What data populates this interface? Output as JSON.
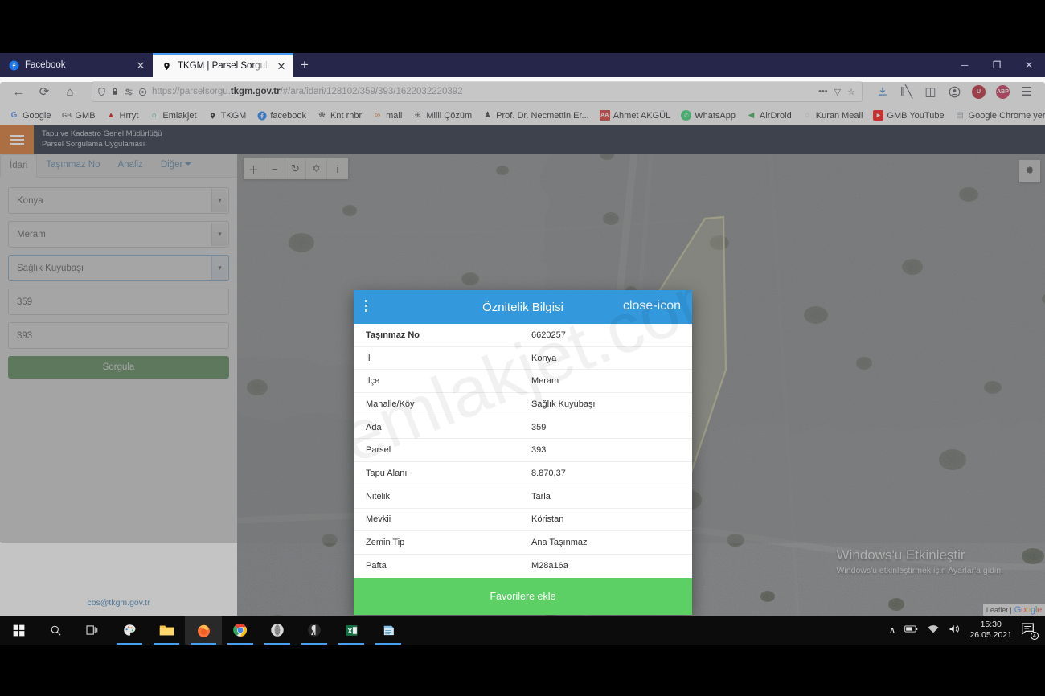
{
  "browser": {
    "tabs": [
      {
        "title": "Facebook",
        "icon": "facebook-icon",
        "active": false
      },
      {
        "title": "TKGM | Parsel Sorgulama Uygu",
        "icon": "map-pin-icon",
        "active": true
      }
    ],
    "new_tab_label": "+",
    "window_controls": {
      "minimize": "─",
      "maximize": "❐",
      "close": "✕"
    },
    "nav": {
      "back": "←",
      "forward": "→",
      "reload": "⟳",
      "home": "⌂"
    },
    "url": {
      "prefix": "https://parselsorgu.",
      "domain": "tkgm.gov.tr",
      "path": "/#/ara/idari/128102/359/393/1622032220392"
    },
    "url_actions": {
      "more": "•••",
      "pocket": "▽",
      "bookmark": "☆"
    },
    "toolbar_right": [
      {
        "name": "downloads-icon",
        "glyph": "⬇"
      },
      {
        "name": "library-icon",
        "glyph": "‖╲"
      },
      {
        "name": "sidebar-icon",
        "glyph": "◫"
      },
      {
        "name": "account-icon",
        "glyph": "◉"
      },
      {
        "name": "ublock-icon",
        "label": "U"
      },
      {
        "name": "adblockplus-icon",
        "label": "ABP"
      },
      {
        "name": "app-menu-icon",
        "glyph": "☰"
      }
    ],
    "bookmarks": [
      {
        "label": "Google",
        "icon": "G",
        "color": "#4285F4"
      },
      {
        "label": "GMB",
        "icon": "GB",
        "color": "#5f6368"
      },
      {
        "label": "Hrryt",
        "icon": "▲",
        "color": "#c00"
      },
      {
        "label": "Emlakjet",
        "icon": "⌂",
        "color": "#16a34a"
      },
      {
        "label": "TKGM",
        "icon": "⚉",
        "color": "#111"
      },
      {
        "label": "facebook",
        "icon": "f",
        "color": "#1877F2"
      },
      {
        "label": "Knt rhbr",
        "icon": "☸",
        "color": "#444"
      },
      {
        "label": "mail",
        "icon": "∞",
        "color": "#e07820"
      },
      {
        "label": "Milli Çözüm",
        "icon": "⊕",
        "color": "#333"
      },
      {
        "label": "Prof. Dr. Necmettin Er...",
        "icon": "♟",
        "color": "#333"
      },
      {
        "label": "Ahmet AKGÜL",
        "icon": "AA",
        "color": "#d32f2f"
      },
      {
        "label": "WhatsApp",
        "icon": "✆",
        "color": "#25D366"
      },
      {
        "label": "AirDroid",
        "icon": "◀",
        "color": "#2fa84f"
      },
      {
        "label": "Kuran Meali",
        "icon": "◌",
        "color": "#888"
      },
      {
        "label": "GMB YouTube",
        "icon": "▶",
        "color": "#FF0000"
      },
      {
        "label": "Google Chrome yer i...",
        "icon": "▤",
        "color": "#9aa0a6"
      }
    ]
  },
  "app": {
    "header": {
      "org_line1": "Tapu ve Kadastro Genel Müdürlüğü",
      "org_line2": "Parsel Sorgulama Uygulaması",
      "menu_icon": "hamburger-icon"
    },
    "sidebar": {
      "tabs": [
        {
          "label": "İdari",
          "active": true
        },
        {
          "label": "Taşınmaz No",
          "active": false
        },
        {
          "label": "Analiz",
          "active": false
        },
        {
          "label": "Diğer",
          "active": false,
          "has_caret": true
        }
      ],
      "fields": [
        {
          "name": "il-select",
          "type": "select",
          "value": "Konya"
        },
        {
          "name": "ilce-select",
          "type": "select",
          "value": "Meram"
        },
        {
          "name": "mahalle-select",
          "type": "select",
          "value": "Sağlık Kuyubaşı",
          "focused": true
        },
        {
          "name": "ada-input",
          "type": "text",
          "value": "359"
        },
        {
          "name": "parsel-input",
          "type": "text",
          "value": "393"
        }
      ],
      "submit_label": "Sorgula",
      "footer_link": "cbs@tkgm.gov.tr"
    },
    "map": {
      "controls": [
        {
          "name": "zoom-in-icon",
          "glyph": "＋"
        },
        {
          "name": "zoom-out-icon",
          "glyph": "−"
        },
        {
          "name": "refresh-icon",
          "glyph": "↻"
        },
        {
          "name": "locate-icon",
          "glyph": "✡"
        },
        {
          "name": "info-icon",
          "glyph": "і"
        }
      ],
      "settings_icon": "gear-icon",
      "attribution_prefix": "Leaflet |",
      "attribution_brand": "Google",
      "parcel_outline_color": "#e8e6a8"
    },
    "modal": {
      "title": "Öznitelik Bilgisi",
      "menu_icon": "vertical-dots-icon",
      "close_icon": "close-icon",
      "rows": [
        {
          "key": "Taşınmaz No",
          "value": "6620257"
        },
        {
          "key": "İl",
          "value": "Konya"
        },
        {
          "key": "İlçe",
          "value": "Meram"
        },
        {
          "key": "Mahalle/Köy",
          "value": "Sağlık Kuyubaşı"
        },
        {
          "key": "Ada",
          "value": "359"
        },
        {
          "key": "Parsel",
          "value": "393"
        },
        {
          "key": "Tapu Alanı",
          "value": "8.870,37"
        },
        {
          "key": "Nitelik",
          "value": "Tarla"
        },
        {
          "key": "Mevkii",
          "value": "Köristan"
        },
        {
          "key": "Zemin Tip",
          "value": "Ana Taşınmaz"
        },
        {
          "key": "Pafta",
          "value": "M28a16a"
        }
      ],
      "favorite_label": "Favorilere ekle",
      "header_color": "#3398dc",
      "footer_color": "#5cd065"
    },
    "watermark": "emlakjet.com"
  },
  "windows": {
    "activation": {
      "line1": "Windows'u Etkinleştir",
      "line2": "Windows'u etkinleştirmek için Ayarlar'a gidin."
    },
    "taskbar": {
      "items": [
        {
          "name": "start-button",
          "glyph": "⊞"
        },
        {
          "name": "search-icon",
          "glyph": "⚲"
        },
        {
          "name": "task-view-icon",
          "glyph": "⌷"
        },
        {
          "name": "paint-icon",
          "glyph": "Ἲ8"
        },
        {
          "name": "file-explorer-icon",
          "glyph": "Ὄ1"
        },
        {
          "name": "firefox-icon",
          "glyph": "●"
        },
        {
          "name": "chrome-icon",
          "glyph": "◉"
        },
        {
          "name": "opera-icon",
          "glyph": "◐"
        },
        {
          "name": "yandex-icon",
          "glyph": "◑"
        },
        {
          "name": "excel-icon",
          "glyph": "X"
        },
        {
          "name": "notepad-icon",
          "glyph": "◧"
        }
      ],
      "tray": {
        "expand": "∧",
        "battery": "ὐb",
        "wifi": "὏6",
        "volume": "ὐa",
        "time": "15:30",
        "date": "26.05.2021",
        "notification_count": "4"
      }
    }
  }
}
